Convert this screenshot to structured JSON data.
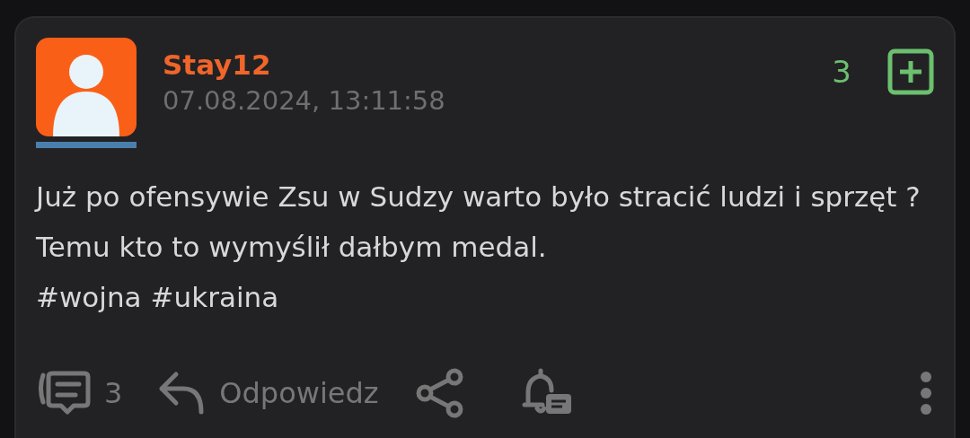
{
  "post": {
    "author": "Stay12",
    "date": "07.08.2024, 13:11:58",
    "score": "3",
    "body": "Już po ofensywie Zsu w Sudzy warto było stracić ludzi i sprzęt ? Temu kto to wymyślił dałbym medal.",
    "tags": [
      "#wojna",
      "#ukraina"
    ],
    "comments": "3",
    "reply": "Odpowiedz"
  }
}
